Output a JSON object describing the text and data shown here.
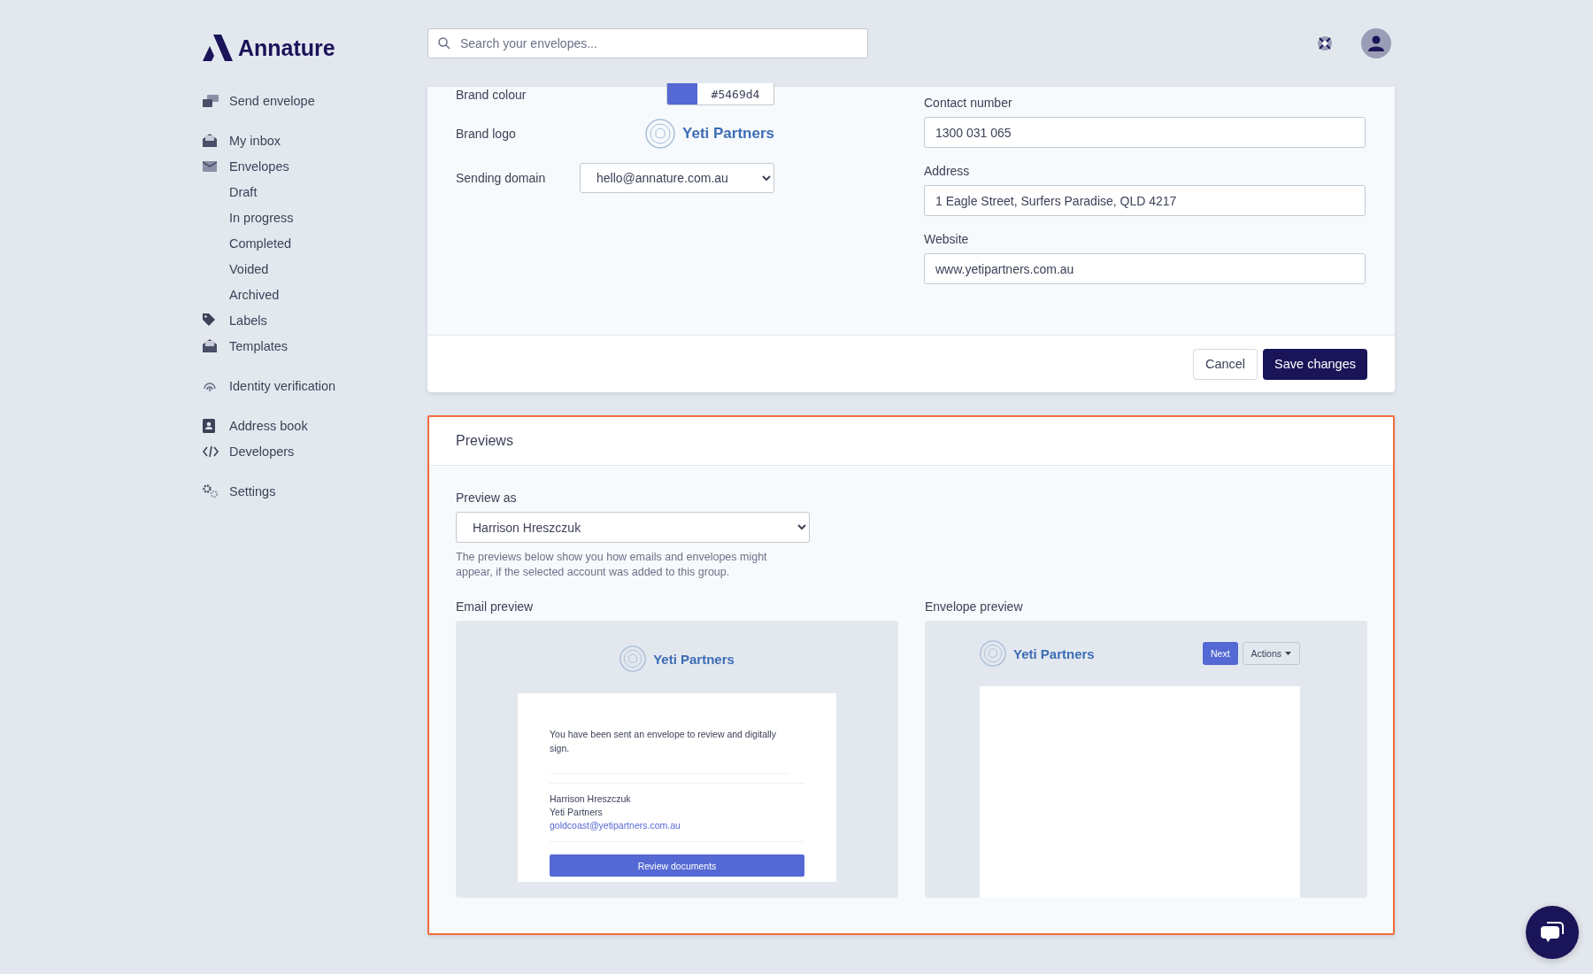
{
  "brand": {
    "name": "Annature"
  },
  "search": {
    "placeholder": "Search your envelopes..."
  },
  "sidebar": {
    "sections": [
      {
        "items": [
          {
            "label": "Send envelope",
            "kind": "send"
          }
        ]
      },
      {
        "items": [
          {
            "label": "My inbox",
            "kind": "inbox"
          },
          {
            "label": "Envelopes",
            "kind": "envelope",
            "children": [
              {
                "label": "Draft"
              },
              {
                "label": "In progress"
              },
              {
                "label": "Completed"
              },
              {
                "label": "Voided"
              },
              {
                "label": "Archived"
              }
            ]
          },
          {
            "label": "Labels",
            "kind": "label"
          },
          {
            "label": "Templates",
            "kind": "inbox"
          }
        ]
      },
      {
        "items": [
          {
            "label": "Identity verification",
            "kind": "fingerprint"
          }
        ]
      },
      {
        "items": [
          {
            "label": "Address book",
            "kind": "book"
          },
          {
            "label": "Developers",
            "kind": "code"
          }
        ]
      },
      {
        "items": [
          {
            "label": "Settings",
            "kind": "settings"
          }
        ]
      }
    ]
  },
  "branding_form": {
    "brand_colour": {
      "label": "Brand colour",
      "value": "#5469d4"
    },
    "brand_logo": {
      "label": "Brand logo",
      "name": "Yeti Partners"
    },
    "sending_domain": {
      "label": "Sending domain",
      "value": "hello@annature.com.au"
    },
    "contact_fields": [
      {
        "label": "Contact number",
        "value": "1300 031 065"
      },
      {
        "label": "Address",
        "value": "1 Eagle Street, Surfers Paradise, QLD 4217"
      },
      {
        "label": "Website",
        "value": "www.yetipartners.com.au"
      }
    ],
    "buttons": [
      {
        "label": "Cancel",
        "kind": "secondary"
      },
      {
        "label": "Save changes",
        "kind": "primary"
      }
    ]
  },
  "previews": {
    "title": "Previews",
    "preview_as": {
      "label": "Preview as",
      "value": "Harrison Hreszczuk",
      "help": "The previews below show you how emails and envelopes might appear, if the selected account was added to this group."
    },
    "email_preview": {
      "label": "Email preview",
      "logo_text": "Yeti Partners",
      "message": "You have been sent an envelope to review and digitally sign.",
      "sender_name": "Harrison Hreszczuk",
      "sender_company": "Yeti Partners",
      "sender_email": "goldcoast@yetipartners.com.au",
      "button": "Review documents"
    },
    "envelope_preview": {
      "label": "Envelope preview",
      "logo_text": "Yeti Partners",
      "buttons": [
        {
          "label": "Next",
          "kind": "primary"
        },
        {
          "label": "Actions",
          "kind": "dropdown"
        }
      ]
    }
  }
}
